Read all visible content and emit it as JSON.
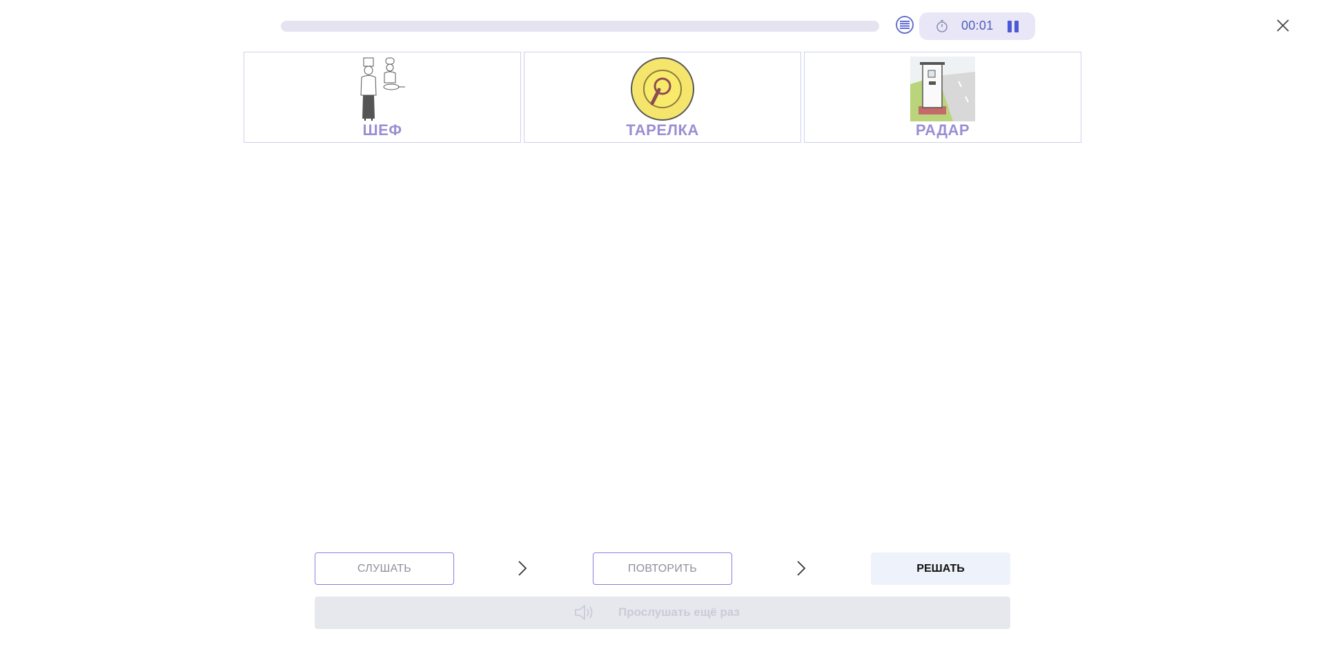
{
  "header": {
    "progress": 0,
    "timer": "00:01",
    "icons": {
      "list": "list-icon",
      "timer": "stopwatch-icon",
      "pause": "pause-icon",
      "close": "close-icon"
    }
  },
  "cards": [
    {
      "label": "ШЕФ",
      "icon": "chef-icon"
    },
    {
      "label": "ТАРЕЛКА",
      "icon": "plate-icon"
    },
    {
      "label": "РАДАР",
      "icon": "radar-icon"
    }
  ],
  "footer": {
    "listen_label": "СЛУШАТЬ",
    "repeat_label": "ПОВТОРИТЬ",
    "solve_label": "РЕШАТЬ",
    "listen_again_label": "Прослушать ещё раз"
  },
  "colors": {
    "accent": "#4c5bd4",
    "card_label": "#9b8ed3",
    "progress_track": "#e6e3f0",
    "timer_bg": "#e9e6f7"
  }
}
